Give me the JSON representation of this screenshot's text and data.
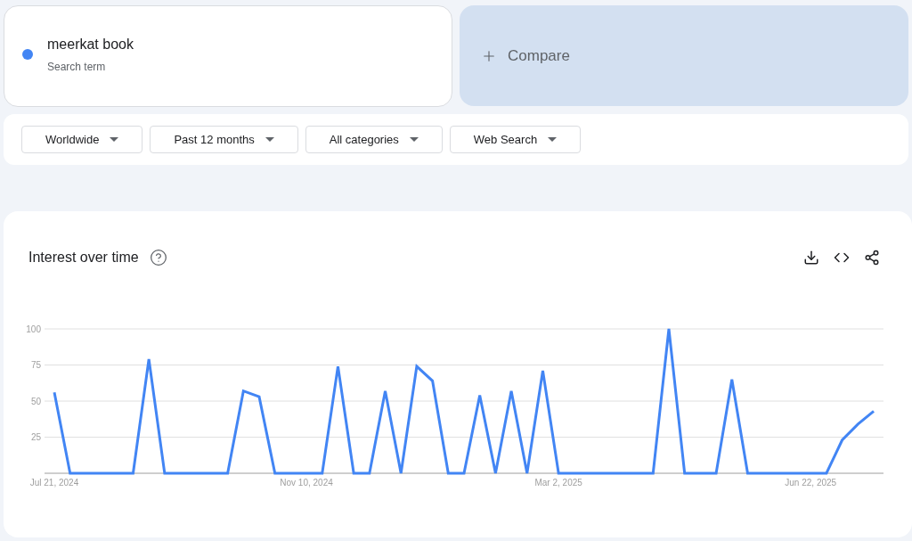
{
  "search_term": {
    "label": "meerkat book",
    "sublabel": "Search term",
    "color": "#4285f4"
  },
  "compare": {
    "label": "Compare"
  },
  "filters": [
    {
      "label": "Worldwide"
    },
    {
      "label": "Past 12 months"
    },
    {
      "label": "All categories"
    },
    {
      "label": "Web Search"
    }
  ],
  "interest_over_time": {
    "title": "Interest over time",
    "chart_data": {
      "type": "line",
      "categories": [
        "Jul 21, 2024",
        null,
        null,
        null,
        null,
        null,
        null,
        null,
        null,
        null,
        null,
        null,
        null,
        null,
        null,
        null,
        "Nov 10, 2024",
        null,
        null,
        null,
        null,
        null,
        null,
        null,
        null,
        null,
        null,
        null,
        null,
        null,
        null,
        null,
        "Mar 2, 2025",
        null,
        null,
        null,
        null,
        null,
        null,
        null,
        null,
        null,
        null,
        null,
        null,
        null,
        null,
        null,
        "Jun 22, 2025",
        null,
        null,
        null,
        null
      ],
      "grid": true,
      "ylim": [
        0,
        100
      ],
      "yticks": [
        {
          "value": 25,
          "label": "25"
        },
        {
          "value": 50,
          "label": "50"
        },
        {
          "value": 75,
          "label": "75"
        },
        {
          "value": 100,
          "label": "100"
        }
      ],
      "series": [
        {
          "color": "#4285f4",
          "values": [
            56,
            0,
            0,
            0,
            0,
            0,
            79,
            0,
            0,
            0,
            0,
            0,
            57,
            53,
            0,
            0,
            0,
            0,
            74,
            0,
            0,
            57,
            0,
            74,
            64,
            0,
            0,
            54,
            0,
            57,
            0,
            71,
            0,
            0,
            0,
            0,
            0,
            0,
            0,
            100,
            0,
            0,
            0,
            65,
            0,
            0,
            0,
            0,
            0,
            0,
            23,
            34,
            43
          ]
        }
      ]
    }
  }
}
